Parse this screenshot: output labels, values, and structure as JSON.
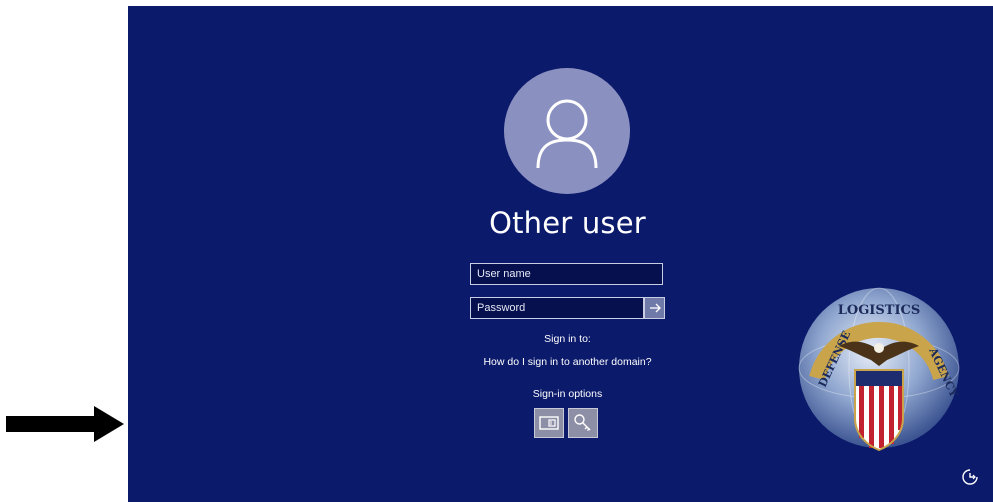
{
  "screen": {
    "top_cut_text": "···· · ····",
    "user_title": "Other user",
    "username_placeholder": "User name",
    "password_placeholder": "Password",
    "sign_in_to_label": "Sign in to:",
    "domain_help_link": "How do I sign in to another domain?",
    "sign_in_options_label": "Sign-in options"
  },
  "seal": {
    "text_top": "LOGISTICS",
    "text_left": "DEFENSE",
    "text_right": "AGENCY"
  },
  "icons": {
    "avatar": "user-silhouette-icon",
    "submit": "arrow-right-icon",
    "smartcard": "smart-card-icon",
    "password_option": "key-icon",
    "accessibility": "ease-of-access-icon",
    "pointer": "black-arrow-icon"
  },
  "colors": {
    "background": "#0b1a6b",
    "avatar": "#8a90c0",
    "field_bg": "#06104f",
    "submit_btn": "#6f7aa8",
    "option_btn": "#8c8fa6"
  }
}
